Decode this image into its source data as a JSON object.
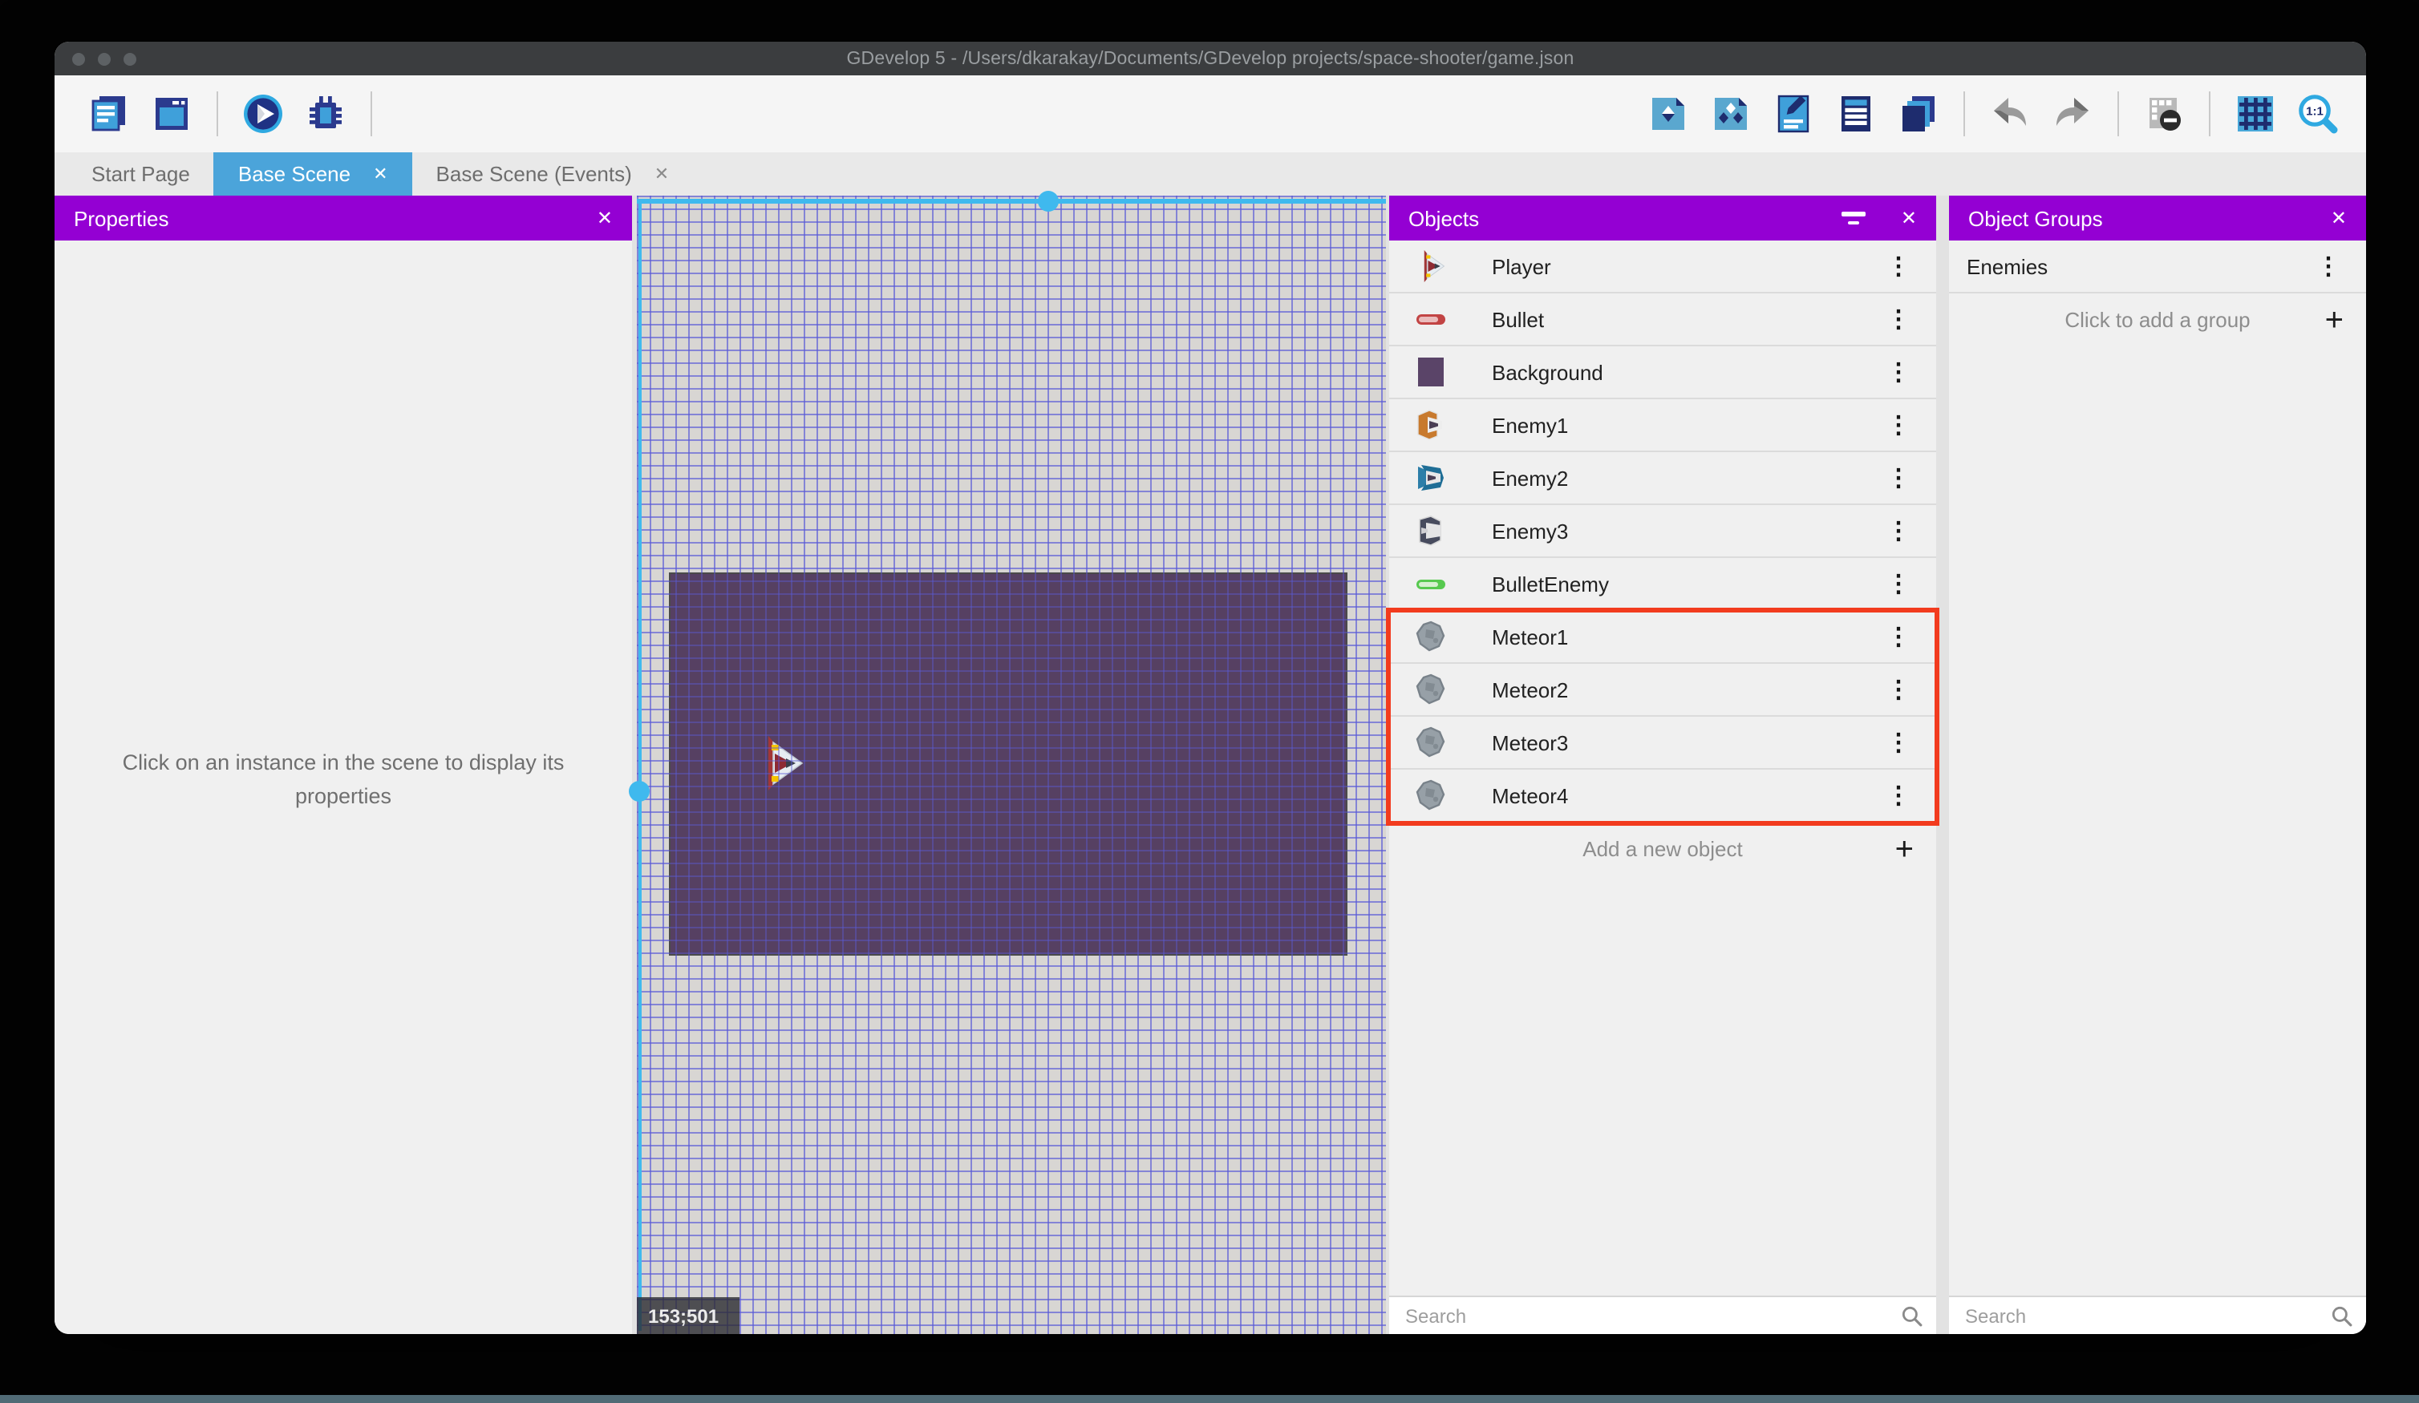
{
  "window": {
    "title": "GDevelop 5 - /Users/dkarakay/Documents/GDevelop projects/space-shooter/game.json"
  },
  "toolbar": {
    "left": [
      {
        "id": "project-manager-button",
        "icon": "project-manager-icon"
      },
      {
        "id": "open-scene-window-button",
        "icon": "scene-window-icon"
      },
      {
        "divider": true
      },
      {
        "id": "preview-play-button",
        "icon": "play-icon"
      },
      {
        "id": "debug-button",
        "icon": "debug-icon"
      },
      {
        "divider": true
      }
    ],
    "right": [
      {
        "id": "edit-object-button",
        "icon": "object-page-icon"
      },
      {
        "id": "edit-instances-button",
        "icon": "instances-page-icon"
      },
      {
        "id": "edit-properties-button",
        "icon": "edit-properties-icon"
      },
      {
        "id": "open-objects-list-button",
        "icon": "objects-list-icon"
      },
      {
        "id": "open-layers-button",
        "icon": "layers-icon"
      },
      {
        "divider": true
      },
      {
        "id": "undo-button",
        "icon": "undo-icon"
      },
      {
        "id": "redo-button",
        "icon": "redo-icon"
      },
      {
        "divider": true
      },
      {
        "id": "render-options-button",
        "icon": "window-mask-icon"
      },
      {
        "divider": true
      },
      {
        "id": "toggle-grid-button",
        "icon": "grid-icon"
      },
      {
        "id": "zoom-original-button",
        "icon": "zoom-1-1-icon"
      }
    ]
  },
  "tabs": [
    {
      "label": "Start Page",
      "active": false,
      "closable": false
    },
    {
      "label": "Base Scene",
      "active": true,
      "closable": true
    },
    {
      "label": "Base Scene (Events)",
      "active": false,
      "closable": true
    }
  ],
  "properties_panel": {
    "title": "Properties",
    "empty_message": "Click on an instance in the scene to display its properties"
  },
  "scene": {
    "coordinates": "153;501"
  },
  "objects_panel": {
    "title": "Objects",
    "items": [
      {
        "name": "Player",
        "icon": "player-ship-icon",
        "highlighted": false
      },
      {
        "name": "Bullet",
        "icon": "bullet-icon",
        "highlighted": false
      },
      {
        "name": "Background",
        "icon": "background-icon",
        "highlighted": false
      },
      {
        "name": "Enemy1",
        "icon": "enemy1-ship-icon",
        "highlighted": false
      },
      {
        "name": "Enemy2",
        "icon": "enemy2-ship-icon",
        "highlighted": false
      },
      {
        "name": "Enemy3",
        "icon": "enemy3-ship-icon",
        "highlighted": false
      },
      {
        "name": "BulletEnemy",
        "icon": "bullet-enemy-icon",
        "highlighted": false
      },
      {
        "name": "Meteor1",
        "icon": "meteor-icon",
        "highlighted": true
      },
      {
        "name": "Meteor2",
        "icon": "meteor-icon",
        "highlighted": true
      },
      {
        "name": "Meteor3",
        "icon": "meteor-icon",
        "highlighted": true
      },
      {
        "name": "Meteor4",
        "icon": "meteor-icon",
        "highlighted": true
      }
    ],
    "add_label": "Add a new object",
    "search_placeholder": "Search"
  },
  "groups_panel": {
    "title": "Object Groups",
    "items": [
      {
        "name": "Enemies"
      }
    ],
    "add_label": "Click to add a group",
    "search_placeholder": "Search"
  },
  "colors": {
    "accent_purple": "#9400d3",
    "tab_active_blue": "#4ba4da",
    "selection_cyan": "#3fb9ee",
    "highlight_red": "#f23b1e",
    "scene_background": "#564062"
  }
}
